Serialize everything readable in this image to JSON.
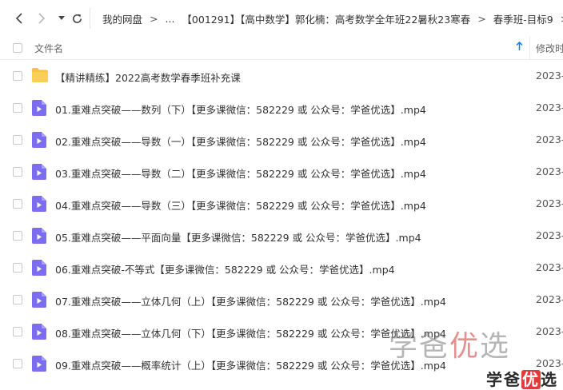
{
  "breadcrumbs": [
    "我的网盘",
    ">",
    "...",
    "【001291】【高中数学】郭化楠：高考数学全年班22暑秋23寒春",
    ">",
    "春季班-目标9",
    ">"
  ],
  "header": {
    "name_label": "文件名",
    "date_label": "修改时"
  },
  "files": [
    {
      "type": "folder",
      "name": "【精讲精练】2022高考数学春季班补充课",
      "date": "2023-"
    },
    {
      "type": "video",
      "name": "01.重难点突破——数列（下）【更多课微信：582229 或 公众号：学爸优选】.mp4",
      "date": "2023-"
    },
    {
      "type": "video",
      "name": "02.重难点突破——导数（一）【更多课微信：582229 或 公众号：学爸优选】.mp4",
      "date": "2023-"
    },
    {
      "type": "video",
      "name": "03.重难点突破——导数（二）【更多课微信：582229 或 公众号：学爸优选】.mp4",
      "date": "2023-"
    },
    {
      "type": "video",
      "name": "04.重难点突破——导数（三）【更多课微信：582229 或 公众号：学爸优选】.mp4",
      "date": "2023-"
    },
    {
      "type": "video",
      "name": "05.重难点突破——平面向量【更多课微信：582229 或 公众号：学爸优选】.mp4",
      "date": "2023-"
    },
    {
      "type": "video",
      "name": "06.重难点突破-不等式【更多课微信：582229 或 公众号：学爸优选】.mp4",
      "date": "2023-"
    },
    {
      "type": "video",
      "name": "07.重难点突破——立体几何（上）【更多课微信：582229 或 公众号：学爸优选】.mp4",
      "date": "2023-"
    },
    {
      "type": "video",
      "name": "08.重难点突破——立体几何（下）【更多课微信：582229 或 公众号：学爸优选】.mp4",
      "date": "2023-"
    },
    {
      "type": "video",
      "name": "09.重难点突破——概率统计（上）【更多课微信：582229 或 公众号：学爸优选】.mp4",
      "date": "2023-"
    }
  ],
  "watermark": {
    "large_a": "学爸",
    "large_b": "优",
    "large_c": "选",
    "small_a": "学爸",
    "small_b": "优",
    "small_c": "选"
  },
  "colors": {
    "folder": "#f6c344",
    "video": "#7b6cf0",
    "accent": "#0a7fff"
  }
}
